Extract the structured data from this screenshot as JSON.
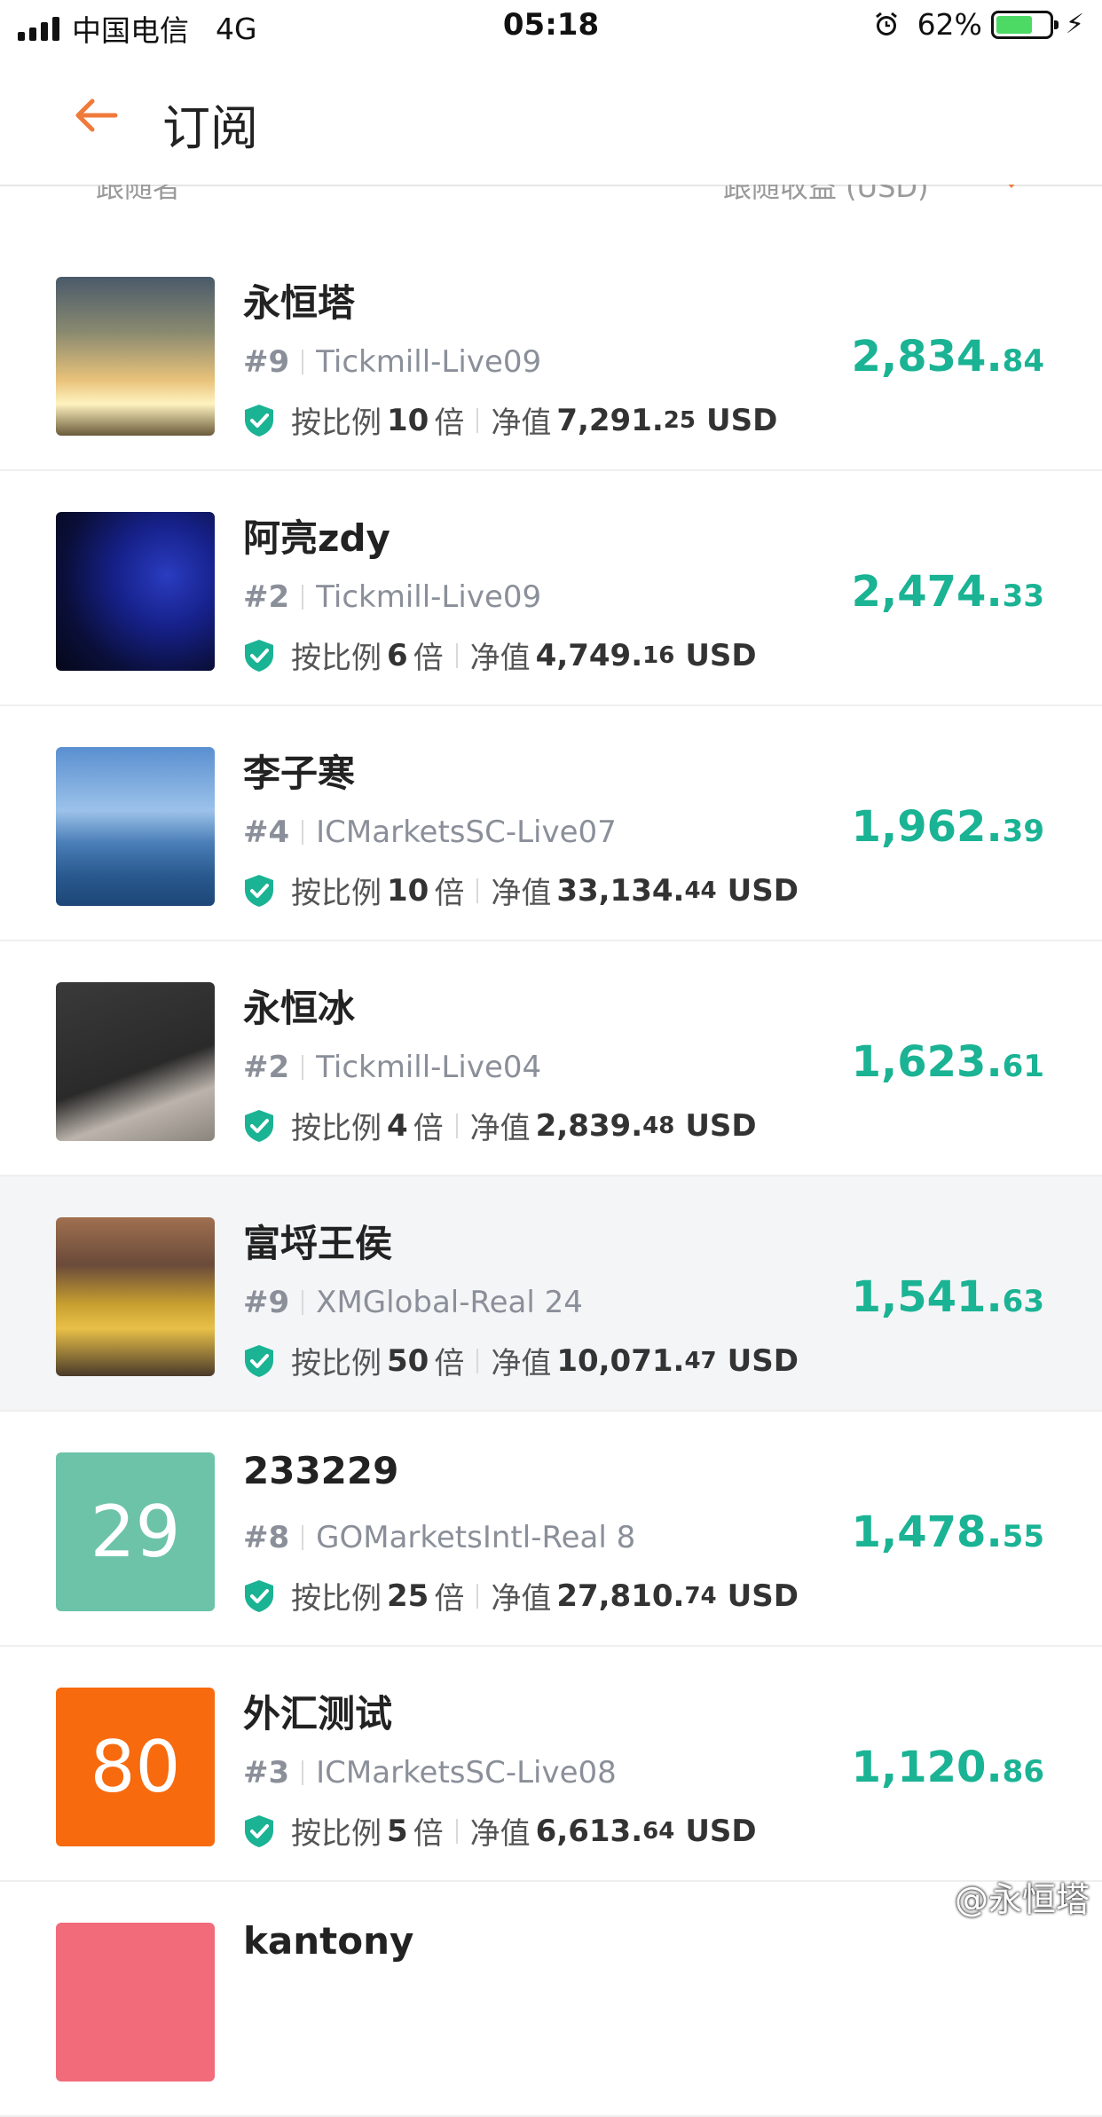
{
  "status_bar": {
    "carrier": "中国电信",
    "network": "4G",
    "time": "05:18",
    "battery": "62%"
  },
  "header": {
    "title": "订阅"
  },
  "columns": {
    "follower": "跟随者",
    "profit": "跟随收益 (USD)"
  },
  "colors": {
    "accent": "#f07a3a",
    "profit": "#1ab394",
    "shield": "#1ab394"
  },
  "rows": [
    {
      "name": "永恒塔",
      "rank": "#9",
      "account": "Tickmill-Live09",
      "ratio_label": "按比例",
      "ratio": "10",
      "ratio_unit": "倍",
      "equity_label": "净值",
      "equity_int": "7,291.",
      "equity_dec": "25",
      "currency": "USD",
      "profit_int": "2,834.",
      "profit_dec": "84",
      "avatar": "sunset-photo"
    },
    {
      "name": "阿亮zdy",
      "rank": "#2",
      "account": "Tickmill-Live09",
      "ratio_label": "按比例",
      "ratio": "6",
      "ratio_unit": "倍",
      "equity_label": "净值",
      "equity_int": "4,749.",
      "equity_dec": "16",
      "currency": "USD",
      "profit_int": "2,474.",
      "profit_dec": "33",
      "avatar": "blue-rose-photo"
    },
    {
      "name": "李子寒",
      "rank": "#4",
      "account": "ICMarketsSC-Live07",
      "ratio_label": "按比例",
      "ratio": "10",
      "ratio_unit": "倍",
      "equity_label": "净值",
      "equity_int": "33,134.",
      "equity_dec": "44",
      "currency": "USD",
      "profit_int": "1,962.",
      "profit_dec": "39",
      "avatar": "mountains-photo"
    },
    {
      "name": "永恒冰",
      "rank": "#2",
      "account": "Tickmill-Live04",
      "ratio_label": "按比例",
      "ratio": "4",
      "ratio_unit": "倍",
      "equity_label": "净值",
      "equity_int": "2,839.",
      "equity_dec": "48",
      "currency": "USD",
      "profit_int": "1,623.",
      "profit_dec": "61",
      "avatar": "cigarette-photo"
    },
    {
      "name": "富埒王侯",
      "rank": "#9",
      "account": "XMGlobal-Real 24",
      "ratio_label": "按比例",
      "ratio": "50",
      "ratio_unit": "倍",
      "equity_label": "净值",
      "equity_int": "10,071.",
      "equity_dec": "47",
      "currency": "USD",
      "profit_int": "1,541.",
      "profit_dec": "63",
      "avatar": "man-gold-photo"
    },
    {
      "name": "233229",
      "rank": "#8",
      "account": "GOMarketsIntl-Real 8",
      "ratio_label": "按比例",
      "ratio": "25",
      "ratio_unit": "倍",
      "equity_label": "净值",
      "equity_int": "27,810.",
      "equity_dec": "74",
      "currency": "USD",
      "profit_int": "1,478.",
      "profit_dec": "55",
      "avatar_text": "29",
      "avatar_color": "#6cc3a8"
    },
    {
      "name": "外汇测试",
      "rank": "#3",
      "account": "ICMarketsSC-Live08",
      "ratio_label": "按比例",
      "ratio": "5",
      "ratio_unit": "倍",
      "equity_label": "净值",
      "equity_int": "6,613.",
      "equity_dec": "64",
      "currency": "USD",
      "profit_int": "1,120.",
      "profit_dec": "86",
      "avatar_text": "80",
      "avatar_color": "#f76a0e"
    },
    {
      "name": "kantony",
      "avatar_color": "#f26b7a"
    }
  ],
  "watermark": "@永恒塔"
}
